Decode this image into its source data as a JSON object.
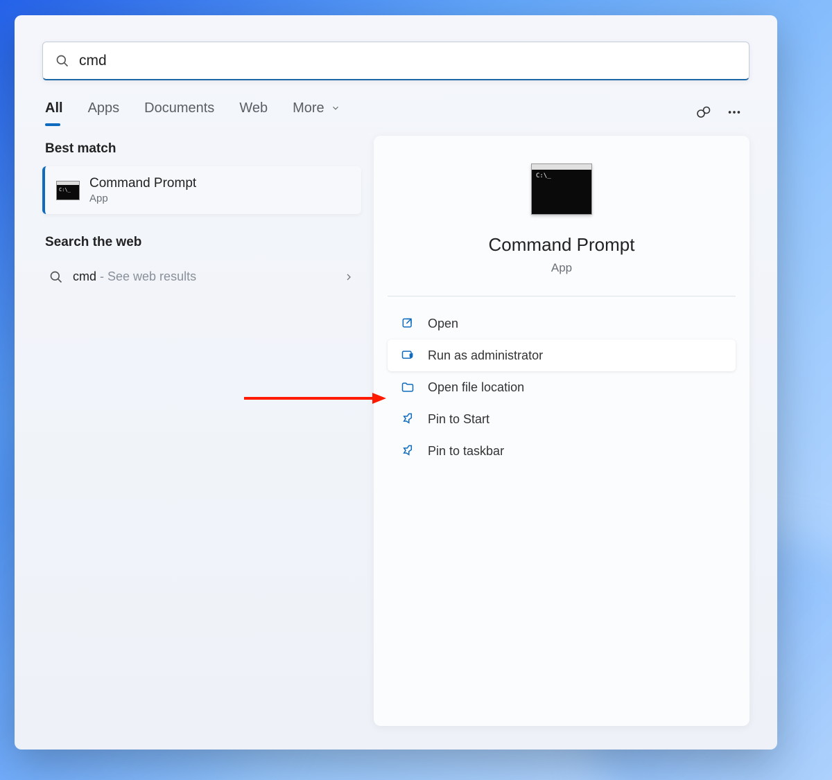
{
  "search": {
    "query": "cmd"
  },
  "tabs": {
    "all": "All",
    "apps": "Apps",
    "documents": "Documents",
    "web": "Web",
    "more": "More"
  },
  "left": {
    "best_match_header": "Best match",
    "best_match": {
      "title": "Command Prompt",
      "subtitle": "App"
    },
    "search_web_header": "Search the web",
    "web_result": {
      "term": "cmd",
      "hint": " - See web results"
    }
  },
  "preview": {
    "title": "Command Prompt",
    "subtitle": "App",
    "actions": {
      "open": "Open",
      "run_admin": "Run as administrator",
      "open_location": "Open file location",
      "pin_start": "Pin to Start",
      "pin_taskbar": "Pin to taskbar"
    }
  }
}
